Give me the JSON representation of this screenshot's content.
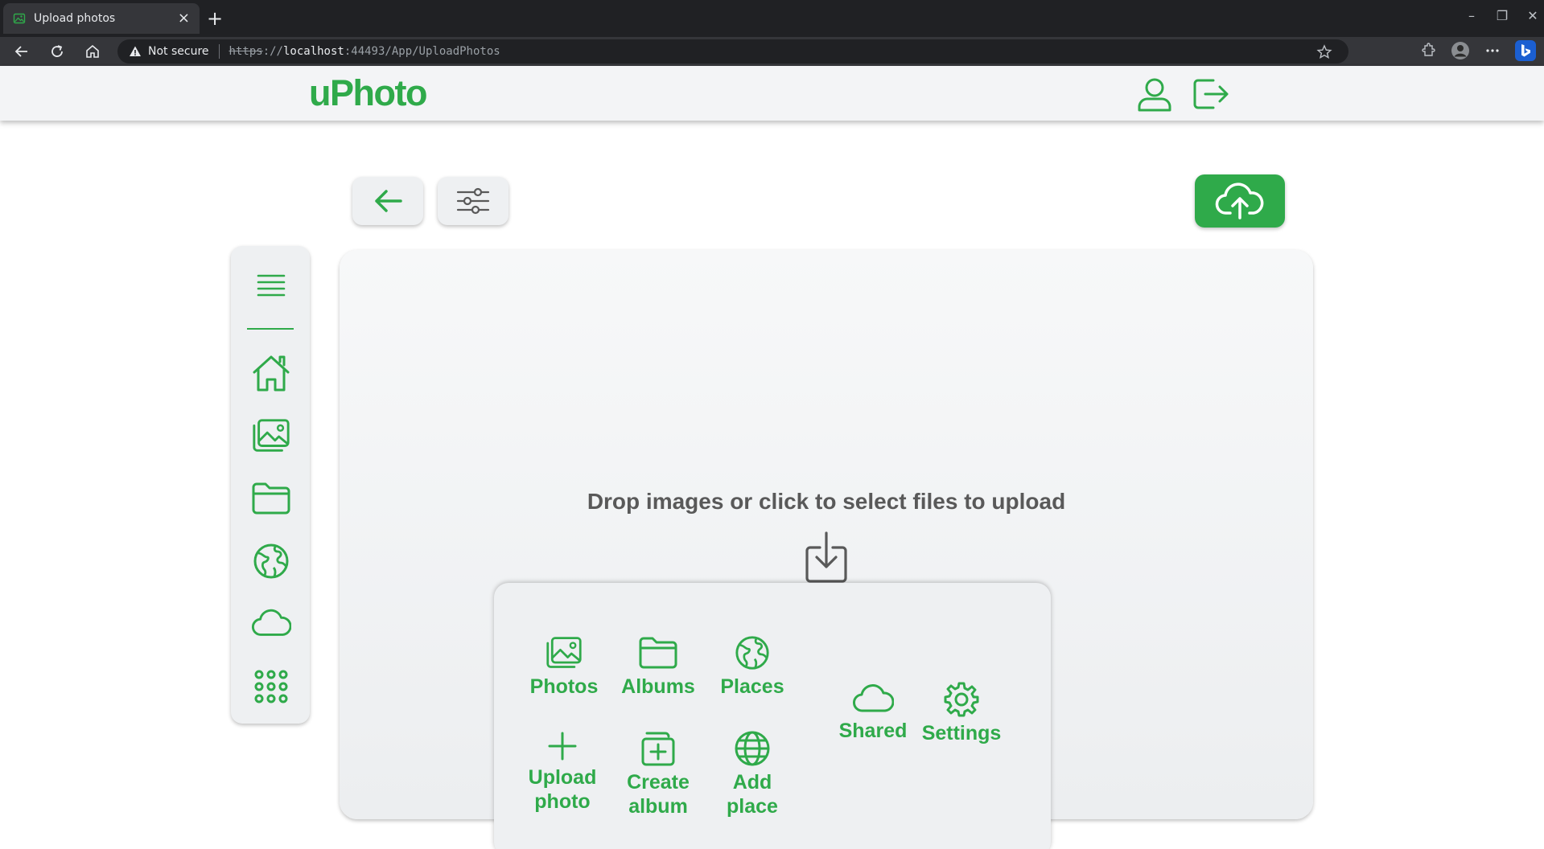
{
  "browser": {
    "tab_title": "Upload photos",
    "tab_close": "×",
    "new_tab": "+",
    "security_text": "Not secure",
    "url_scheme": "https",
    "url_sep": "://",
    "url_host": "localhost",
    "url_rest": ":44493/App/UploadPhotos",
    "window_minimize": "–",
    "window_restore": "❐",
    "window_close": "✕"
  },
  "app": {
    "logo": "uPhoto",
    "drop_prompt": "Drop images or click to select files to upload"
  },
  "icons": {
    "header": [
      "user-icon",
      "logout-icon"
    ],
    "toolbar": [
      "arrow-left-icon",
      "sliders-icon",
      "cloud-upload-icon"
    ],
    "sidebar": [
      "menu-icon",
      "home-icon",
      "photos-icon",
      "folder-icon",
      "globe-icon",
      "cloud-icon",
      "apps-grid-icon"
    ]
  },
  "quick_menu": {
    "photos": "Photos",
    "albums": "Albums",
    "places": "Places",
    "shared": "Shared",
    "settings": "Settings",
    "upload_photo_1": "Upload",
    "upload_photo_2": "photo",
    "create_album_1": "Create",
    "create_album_2": "album",
    "add_place_1": "Add",
    "add_place_2": "place"
  },
  "colors": {
    "accent": "#2faa4a",
    "chrome_dark": "#202124",
    "chrome_mid": "#35363a",
    "text_gray": "#595959"
  }
}
